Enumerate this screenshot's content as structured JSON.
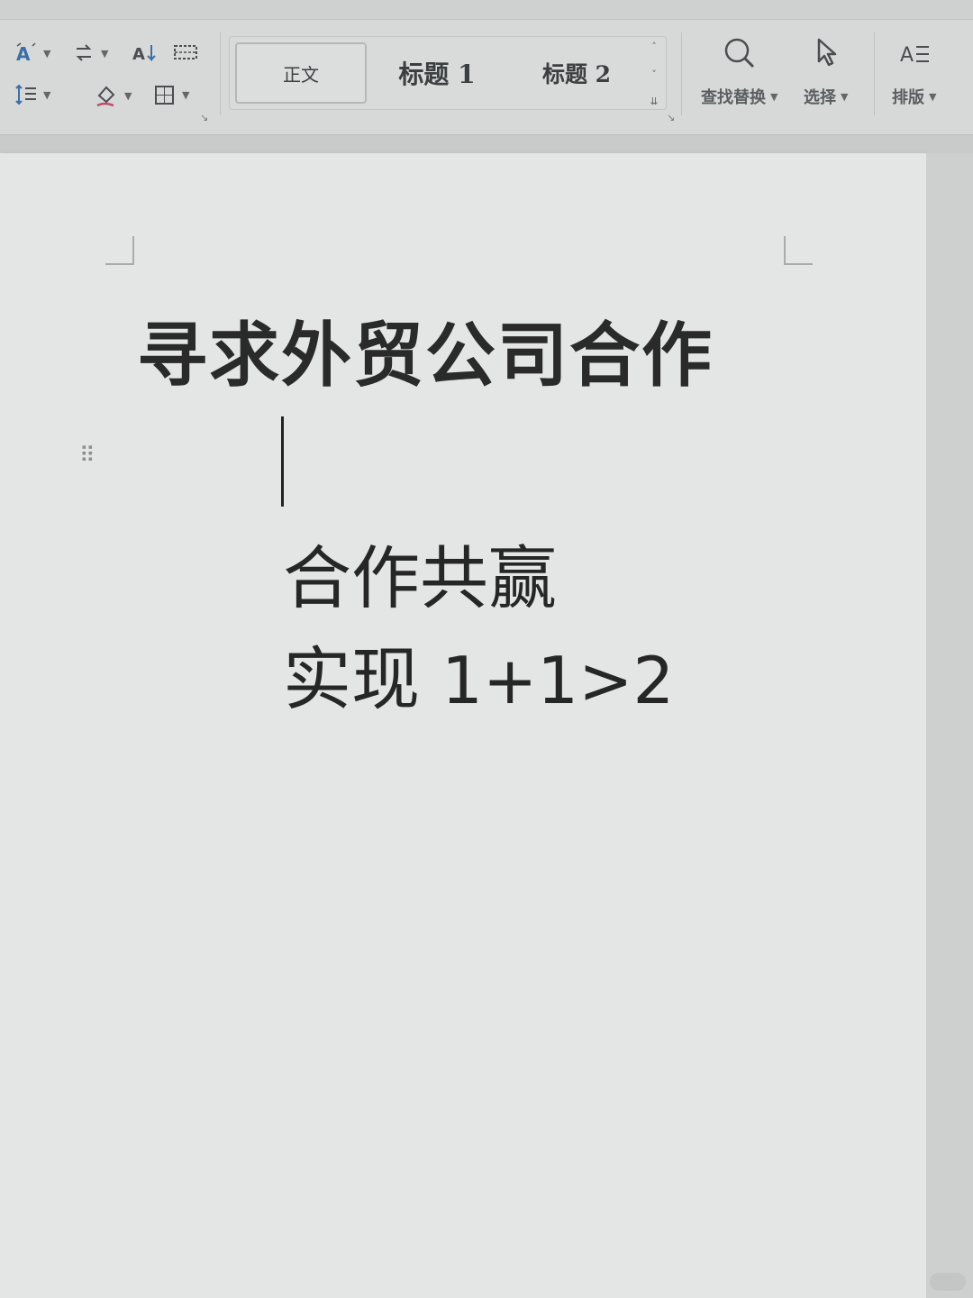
{
  "ribbon": {
    "styles": {
      "normal": "正文",
      "heading1": "标题 1",
      "heading2": "标题 2"
    },
    "tools": {
      "find_replace": "查找替换",
      "select": "选择",
      "layout": "排版"
    },
    "icons": [
      "font-effects-icon",
      "text-direction-icon",
      "sort-icon",
      "table-grid-icon",
      "line-spacing-icon",
      "shading-icon",
      "border-icon",
      "search-icon",
      "cursor-select-icon",
      "typesetting-icon"
    ]
  },
  "document": {
    "title": "寻求外贸公司合作",
    "line1": "合作共赢",
    "line2_prefix": "实现",
    "line2_formula": "1+1>2"
  },
  "colors": {
    "ribbon_bg": "#d7d9d9",
    "page_bg": "#e4e6e6",
    "text": "#262626"
  }
}
